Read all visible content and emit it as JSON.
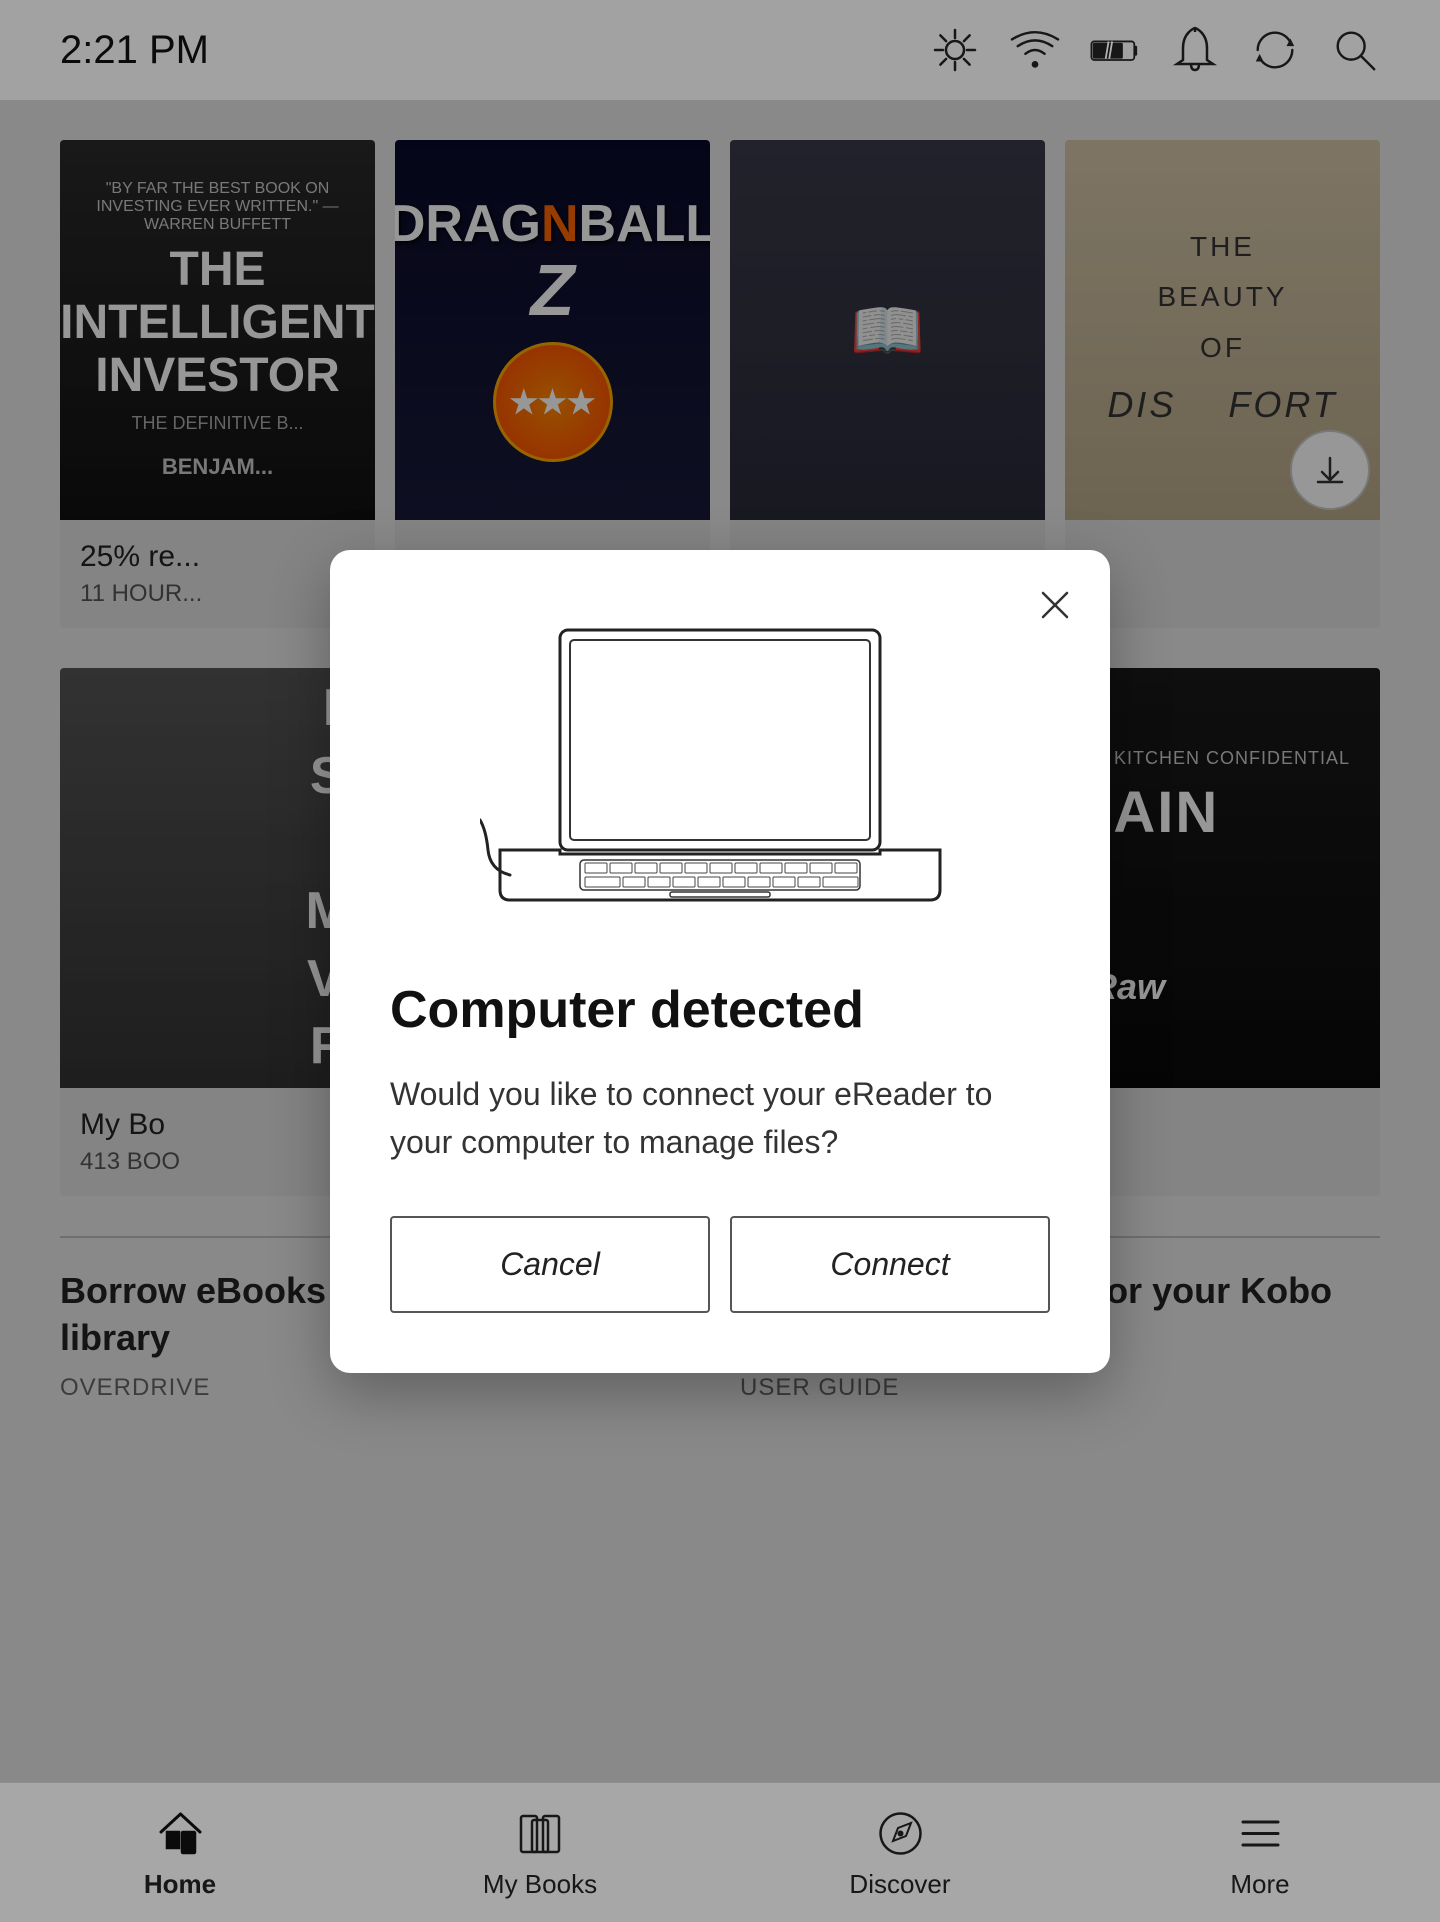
{
  "statusBar": {
    "time": "2:21 PM"
  },
  "booksRow1": [
    {
      "title": "THE INTELLIGENT INVESTOR",
      "author": "BENJAMI",
      "progress": "25% re",
      "hours": "11 HOUR",
      "coverStyle": "dark"
    },
    {
      "title": "DRAGON BALL Z",
      "progress": "",
      "hours": "",
      "coverStyle": "dragonball"
    },
    {
      "title": "",
      "progress": "",
      "hours": "",
      "coverStyle": "manga"
    },
    {
      "title": "THE BEAUTY OF Dis  fort",
      "progress": "",
      "hours": "",
      "coverStyle": "beige",
      "hasDownload": true
    }
  ],
  "booksRow2": [
    {
      "lines": [
        "MA",
        "SEA",
        "F",
        "MEA",
        "VIKT",
        "FRA"
      ],
      "info": "",
      "coverStyle": "dark-text"
    },
    {
      "title": "BOURDAIN",
      "subtitle": "Medium Raw",
      "info": "",
      "coverStyle": "bourdain"
    }
  ],
  "myBooks": {
    "title": "My Bo",
    "count": "413 BOO"
  },
  "sectionLinks": [
    {
      "title": "Borrow eBooks from your public library",
      "subtitle": "OVERDRIVE"
    },
    {
      "title": "Read the user guide for your Kobo Forma",
      "subtitle": "USER GUIDE"
    }
  ],
  "bottomNav": [
    {
      "label": "Home",
      "icon": "home-icon",
      "active": true
    },
    {
      "label": "My Books",
      "icon": "mybooks-icon",
      "active": false
    },
    {
      "label": "Discover",
      "icon": "discover-icon",
      "active": false
    },
    {
      "label": "More",
      "icon": "more-icon",
      "active": false
    }
  ],
  "modal": {
    "title": "Computer detected",
    "body": "Would you like to connect your eReader to your computer to manage files?",
    "cancelLabel": "Cancel",
    "connectLabel": "Connect"
  }
}
